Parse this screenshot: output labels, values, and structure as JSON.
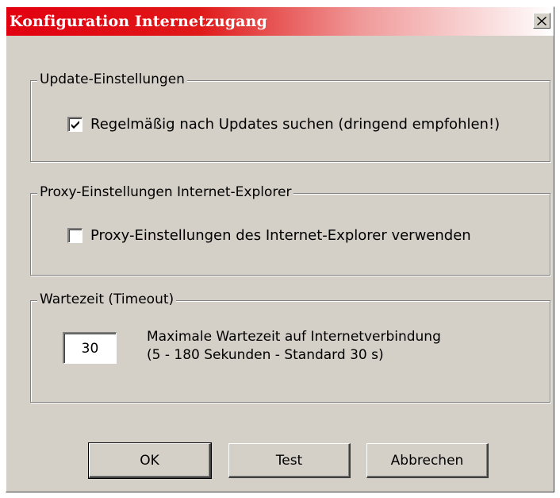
{
  "window": {
    "title": "Konfiguration Internetzugang",
    "close_glyph": "✕"
  },
  "update_group": {
    "legend": "Update-Einstellungen",
    "checkbox_label": "Regelmäßig nach Updates suchen (dringend empfohlen!)",
    "checked": true
  },
  "proxy_group": {
    "legend": "Proxy-Einstellungen Internet-Explorer",
    "checkbox_label": "Proxy-Einstellungen des Internet-Explorer verwenden",
    "checked": false
  },
  "timeout_group": {
    "legend": "Wartezeit (Timeout)",
    "value": "30",
    "desc_line1": "Maximale Wartezeit auf Internetverbindung",
    "desc_line2": "(5 - 180 Sekunden - Standard 30 s)"
  },
  "buttons": {
    "ok": "OK",
    "test": "Test",
    "cancel": "Abbrechen"
  },
  "colors": {
    "title_start": "#e20010",
    "dialog_bg": "#d4d0c8"
  }
}
